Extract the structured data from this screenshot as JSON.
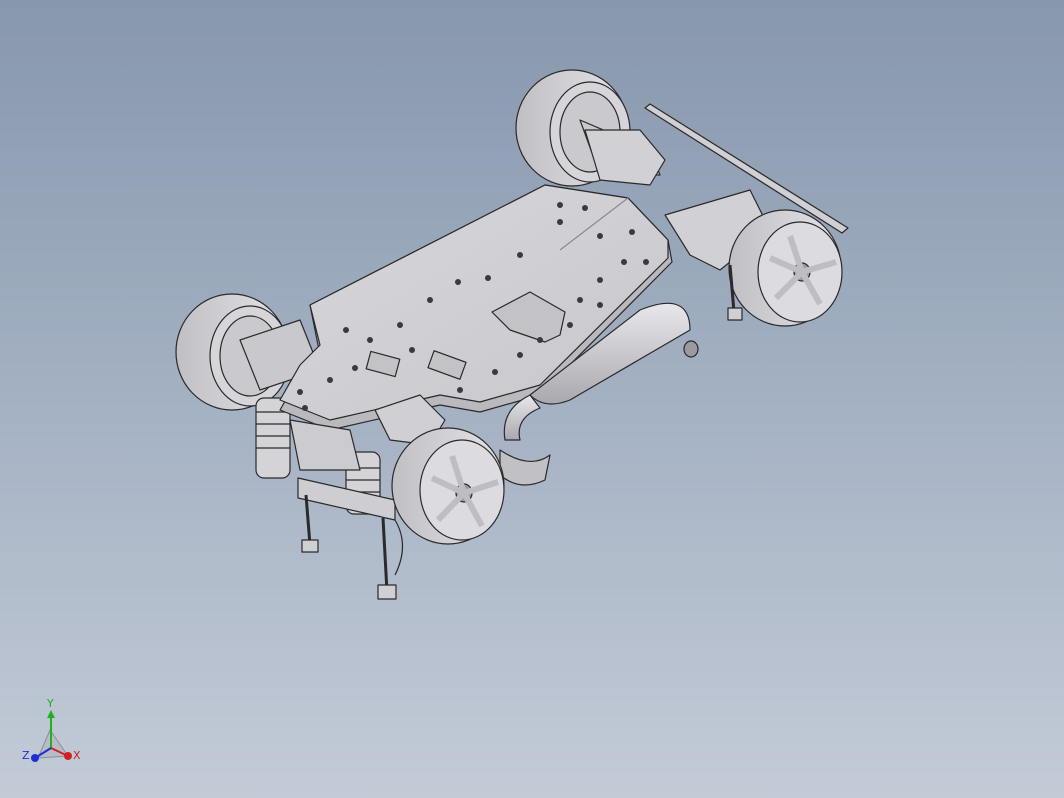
{
  "viewport": {
    "background_top": "#8797ad",
    "background_bottom": "#c3cbd7"
  },
  "model": {
    "icon": "rc-car-chassis-icon",
    "part_color": "#d2d2d6",
    "edge_color": "#2a2a2a",
    "wheel_count": 4
  },
  "triad": {
    "x_label": "X",
    "y_label": "Y",
    "z_label": "Z",
    "x_color": "#d02020",
    "y_color": "#20b020",
    "z_color": "#2030d0"
  }
}
